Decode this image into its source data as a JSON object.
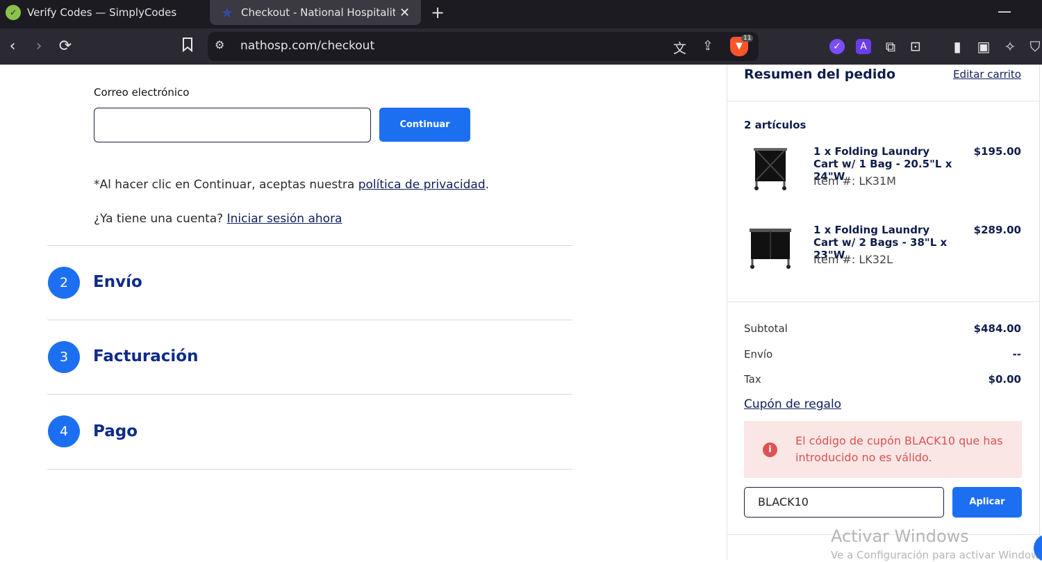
{
  "browser": {
    "tabs": [
      {
        "title": "Verify Codes — SimplyCodes",
        "icon": "simplycodes-icon"
      },
      {
        "title": "Checkout - National Hospitality S",
        "icon": "star-icon",
        "active": true
      }
    ],
    "new_tab": "+",
    "url": "nathosp.com/checkout",
    "brave_badge": "11"
  },
  "contact": {
    "email_label": "Correo electrónico",
    "email_value": "",
    "continue_label": "Continuar",
    "privacy_prefix": "*Al hacer clic en Continuar, aceptas nuestra ",
    "privacy_link": "política de privacidad",
    "privacy_suffix": ".",
    "account_prefix": "¿Ya tiene una cuenta? ",
    "account_link": "Iniciar sesión ahora"
  },
  "steps": [
    {
      "number": "2",
      "title": "Envío"
    },
    {
      "number": "3",
      "title": "Facturación"
    },
    {
      "number": "4",
      "title": "Pago"
    }
  ],
  "summary": {
    "title": "Resumen del pedido",
    "edit_cart": "Editar carrito",
    "count": "2 artículos",
    "items": [
      {
        "name": "1 x Folding Laundry Cart w/ 1 Bag - 20.5\"L x 24\"W",
        "sku": "Item #: LK31M",
        "price": "$195.00"
      },
      {
        "name": "1 x Folding Laundry Cart w/ 2 Bags - 38\"L x 23\"W",
        "sku": "Item #: LK32L",
        "price": "$289.00"
      }
    ],
    "subtotal_label": "Subtotal",
    "subtotal_value": "$484.00",
    "shipping_label": "Envío",
    "shipping_value": "--",
    "tax_label": "Tax",
    "tax_value": "$0.00",
    "gift_coupon": "Cupón de regalo",
    "error_message": "El código de cupón BLACK10 que has introducido no es válido.",
    "coupon_value": "BLACK10",
    "apply_label": "Aplicar"
  },
  "watermark": {
    "line1": "Activar Windows",
    "line2": "Ve a Configuración para activar Windows."
  },
  "colors": {
    "accent": "#1d6ff2",
    "navy": "#0f1d4c",
    "error_bg": "#fbe6e6",
    "error_text": "#d9534f"
  }
}
